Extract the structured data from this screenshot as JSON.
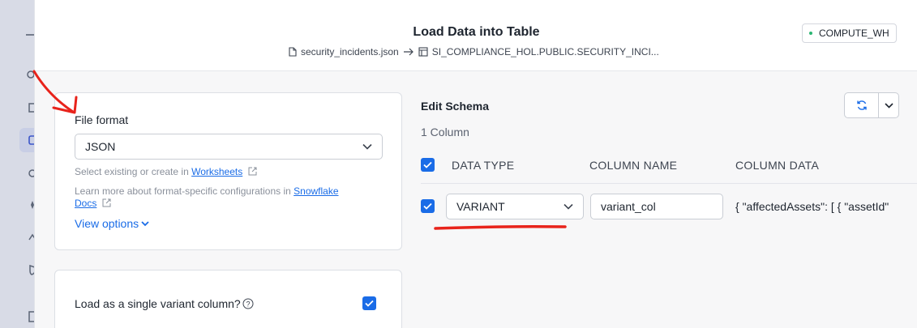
{
  "modal": {
    "title": "Load Data into Table",
    "source_file": "security_incidents.json",
    "target_table": "SI_COMPLIANCE_HOL.PUBLIC.SECURITY_INCI...",
    "warehouse": "COMPUTE_WH"
  },
  "file_format": {
    "label": "File format",
    "selected": "JSON",
    "hint_prefix": "Select existing or create in ",
    "hint_link": "Worksheets",
    "docs_prefix": "Learn more about format-specific configurations in ",
    "docs_link_1": "Snowflake",
    "docs_link_2": "Docs",
    "view_options": "View options"
  },
  "variant_card": {
    "label": "Load as a single variant column?",
    "checked": true
  },
  "schema": {
    "title": "Edit Schema",
    "column_count": "1 Column",
    "headers": [
      "DATA TYPE",
      "COLUMN NAME",
      "COLUMN DATA"
    ],
    "rows": [
      {
        "checked": true,
        "data_type": "VARIANT",
        "column_name": "variant_col",
        "column_data": "{ \"affectedAssets\": [ { \"assetId\""
      }
    ]
  },
  "colors": {
    "accent": "#1a6ce7",
    "annotation": "#e8231b",
    "status_dot": "#2bb673"
  }
}
